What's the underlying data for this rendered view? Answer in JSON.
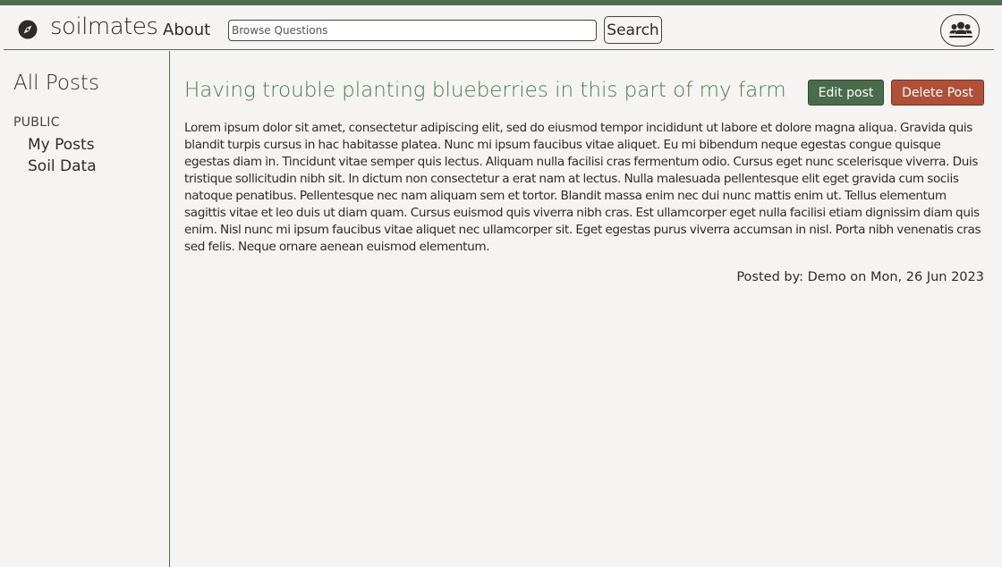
{
  "colors": {
    "accent": "#4e6e4f",
    "title": "#4e7a50",
    "edit_button_bg": "#4a6c4b",
    "delete_button_bg": "#b05038",
    "background": "#f5f4f2"
  },
  "navbar": {
    "logo_icon": "compass-icon",
    "brand": "soilmates",
    "about_label": "About",
    "search": {
      "placeholder": "Browse Questions",
      "value": ""
    },
    "search_button_label": "Search",
    "user_menu_icon": "users-icon"
  },
  "sidebar": {
    "title": "All Posts",
    "section_label": "PUBLIC",
    "items": [
      {
        "label": "My Posts"
      },
      {
        "label": "Soil Data"
      }
    ]
  },
  "post": {
    "title": "Having trouble planting blueberries in this part of my farm",
    "edit_label": "Edit post",
    "delete_label": "Delete Post",
    "body": "Lorem ipsum dolor sit amet, consectetur adipiscing elit, sed do eiusmod tempor incididunt ut labore et dolore magna aliqua. Gravida quis blandit turpis cursus in hac habitasse platea. Nunc mi ipsum faucibus vitae aliquet. Eu mi bibendum neque egestas congue quisque egestas diam in. Tincidunt vitae semper quis lectus. Aliquam nulla facilisi cras fermentum odio. Cursus eget nunc scelerisque viverra. Duis tristique sollicitudin nibh sit. In dictum non consectetur a erat nam at lectus. Nulla malesuada pellentesque elit eget gravida cum sociis natoque penatibus. Pellentesque nec nam aliquam sem et tortor. Blandit massa enim nec dui nunc mattis enim ut. Tellus elementum sagittis vitae et leo duis ut diam quam. Cursus euismod quis viverra nibh cras. Est ullamcorper eget nulla facilisi etiam dignissim diam quis enim. Nisl nunc mi ipsum faucibus vitae aliquet nec ullamcorper sit. Eget egestas purus viverra accumsan in nisl. Porta nibh venenatis cras sed felis. Neque ornare aenean euismod elementum.",
    "meta": "Posted by: Demo on Mon, 26 Jun 2023"
  }
}
